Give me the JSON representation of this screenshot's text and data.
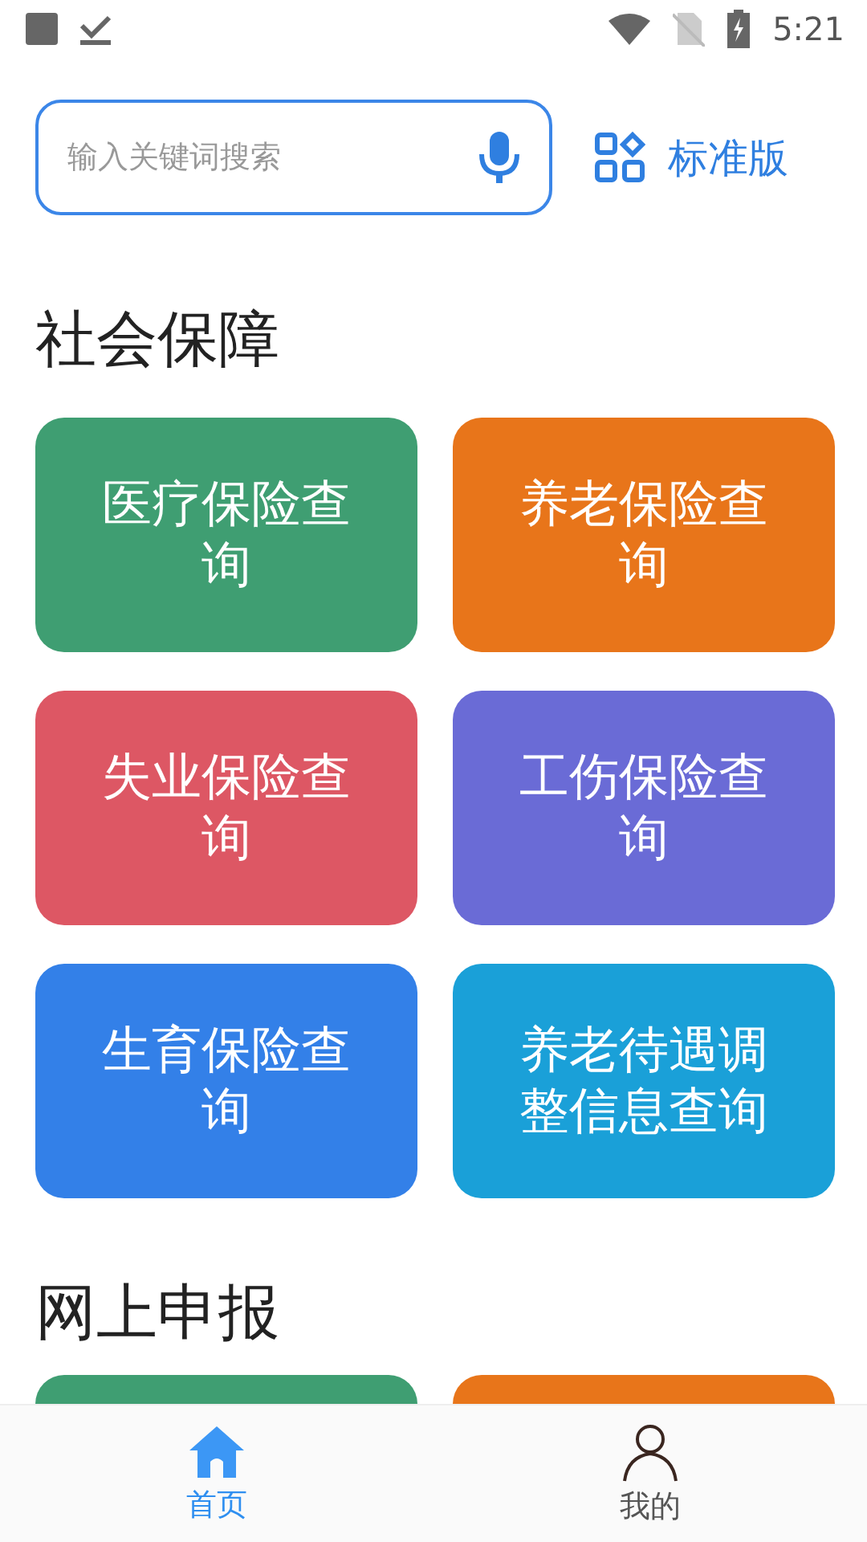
{
  "status_bar": {
    "time": "5:21"
  },
  "search": {
    "placeholder": "输入关键词搜索"
  },
  "version_button": {
    "label": "标准版"
  },
  "sections": [
    {
      "title": "社会保障",
      "cards": [
        {
          "label": "医疗保险查询",
          "color": "#3f9e72"
        },
        {
          "label": "养老保险查询",
          "color": "#e8751a"
        },
        {
          "label": "失业保险查询",
          "color": "#dd5764"
        },
        {
          "label": "工伤保险查询",
          "color": "#6a6bd6"
        },
        {
          "label": "生育保险查询",
          "color": "#3380e8"
        },
        {
          "label": "养老待遇调整信息查询",
          "color": "#1aa0d8"
        }
      ]
    },
    {
      "title": "网上申报",
      "cards": [
        {
          "color": "#3f9e72"
        },
        {
          "color": "#e8751a"
        }
      ]
    }
  ],
  "tabs": [
    {
      "label": "首页",
      "kind": "home",
      "selected": true
    },
    {
      "label": "我的",
      "kind": "person",
      "selected": false
    }
  ]
}
